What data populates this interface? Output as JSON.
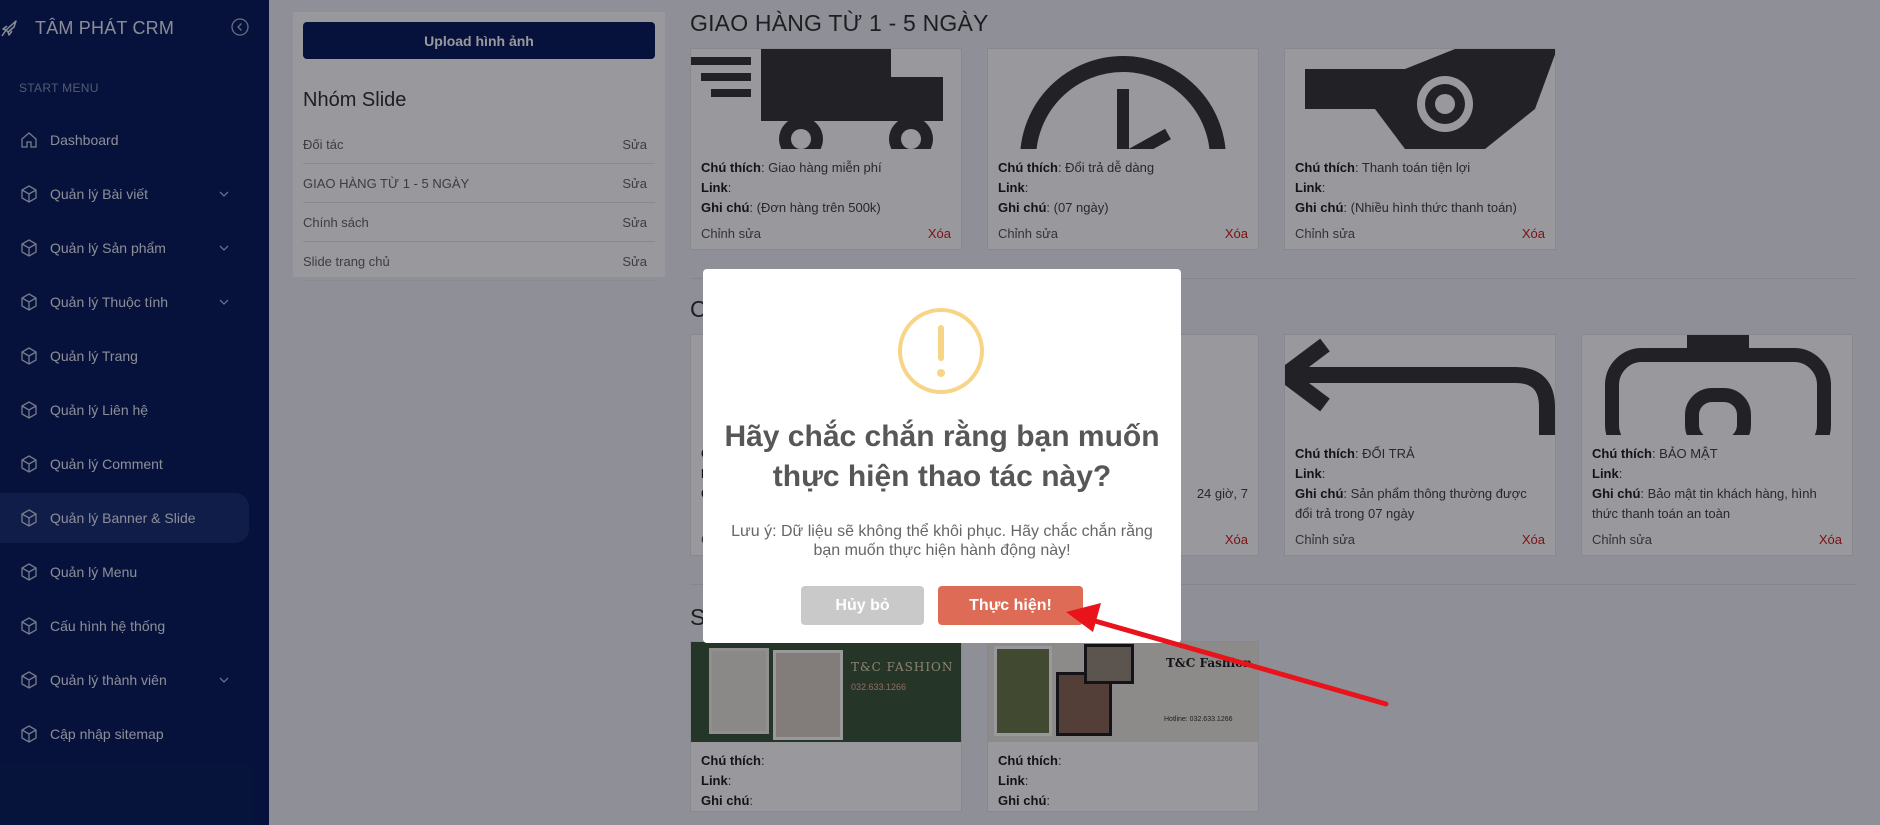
{
  "sidebar": {
    "brand": "TÂM PHÁT CRM",
    "section_label": "START MENU",
    "items": [
      {
        "label": "Dashboard",
        "has_submenu": false
      },
      {
        "label": "Quản lý Bài viết",
        "has_submenu": true
      },
      {
        "label": "Quản lý Sản phẩm",
        "has_submenu": true
      },
      {
        "label": "Quản lý Thuộc tính",
        "has_submenu": true
      },
      {
        "label": "Quản lý Trang",
        "has_submenu": false
      },
      {
        "label": "Quản lý Liên hệ",
        "has_submenu": false
      },
      {
        "label": "Quản lý Comment",
        "has_submenu": false
      },
      {
        "label": "Quản lý Banner & Slide",
        "has_submenu": false,
        "active": true
      },
      {
        "label": "Quản lý Menu",
        "has_submenu": false
      },
      {
        "label": "Cấu hình hệ thống",
        "has_submenu": false
      },
      {
        "label": "Quản lý thành viên",
        "has_submenu": true
      },
      {
        "label": "Cập nhập sitemap",
        "has_submenu": false
      }
    ]
  },
  "left_panel": {
    "upload_label": "Upload hình ảnh",
    "group_title": "Nhóm Slide",
    "groups": [
      {
        "name": "Đối tác",
        "action": "Sửa"
      },
      {
        "name": "GIAO HÀNG TỪ 1 - 5 NGÀY",
        "action": "Sửa"
      },
      {
        "name": "Chính sách",
        "action": "Sửa"
      },
      {
        "name": "Slide trang chủ",
        "action": "Sửa"
      }
    ]
  },
  "labels": {
    "caption": "Chú thích",
    "link": "Link",
    "note": "Ghi chú",
    "edit": "Chỉnh sửa",
    "delete": "Xóa"
  },
  "sections": {
    "s1": {
      "title": "GIAO HÀNG TỪ 1 - 5 NGÀY",
      "cards": [
        {
          "caption": ": Giao hàng miễn phí",
          "link": ":",
          "note": ": (Đơn hàng trên 500k)"
        },
        {
          "caption": ": Đổi trả dễ dàng",
          "link": ":",
          "note": ": (07 ngày)"
        },
        {
          "caption": ": Thanh toán tiện lợi",
          "link": ":",
          "note": ": (Nhiều hình thức thanh toán)"
        }
      ]
    },
    "s2": {
      "title": "C",
      "cards": [
        {
          "caption": "",
          "link": "",
          "note": ""
        },
        {
          "caption": "",
          "link": "",
          "note": " 24 giờ, 7"
        },
        {
          "caption": ": ĐỔI TRẢ",
          "link": ":",
          "note": ": Sản phẩm thông thường được đổi trả trong 07 ngày"
        },
        {
          "caption": ": BẢO MẬT",
          "link": ":",
          "note": ": Bảo mật tin khách hàng, hình thức thanh toán an toàn"
        }
      ]
    },
    "s3": {
      "title": "S",
      "cards": [
        {
          "caption": ":",
          "link": ":",
          "note": ":",
          "banner_title": "T&C FASHION",
          "banner_phone": "032.633.1266"
        },
        {
          "caption": ":",
          "link": ":",
          "note": ":",
          "banner_title": "T&C Fashion",
          "banner_phone": "Hotline: 032.633.1266"
        }
      ]
    }
  },
  "modal": {
    "title": "Hãy chắc chắn rằng bạn muốn thực hiện thao tác này?",
    "text": "Lưu ý: Dữ liệu sẽ không thể khôi phục. Hãy chắc chắn rằng bạn muốn thực hiện hành động này!",
    "cancel_label": "Hủy bỏ",
    "confirm_label": "Thực hiện!",
    "icon": "warning-icon",
    "icon_color": "#f8d486",
    "confirm_color": "#dd6b55",
    "cancel_color": "#c9c9c9"
  },
  "colors": {
    "sidebar_bg": "#0a1f5c",
    "delete_red": "#d01e1e",
    "annotation_arrow": "#e8131b"
  }
}
